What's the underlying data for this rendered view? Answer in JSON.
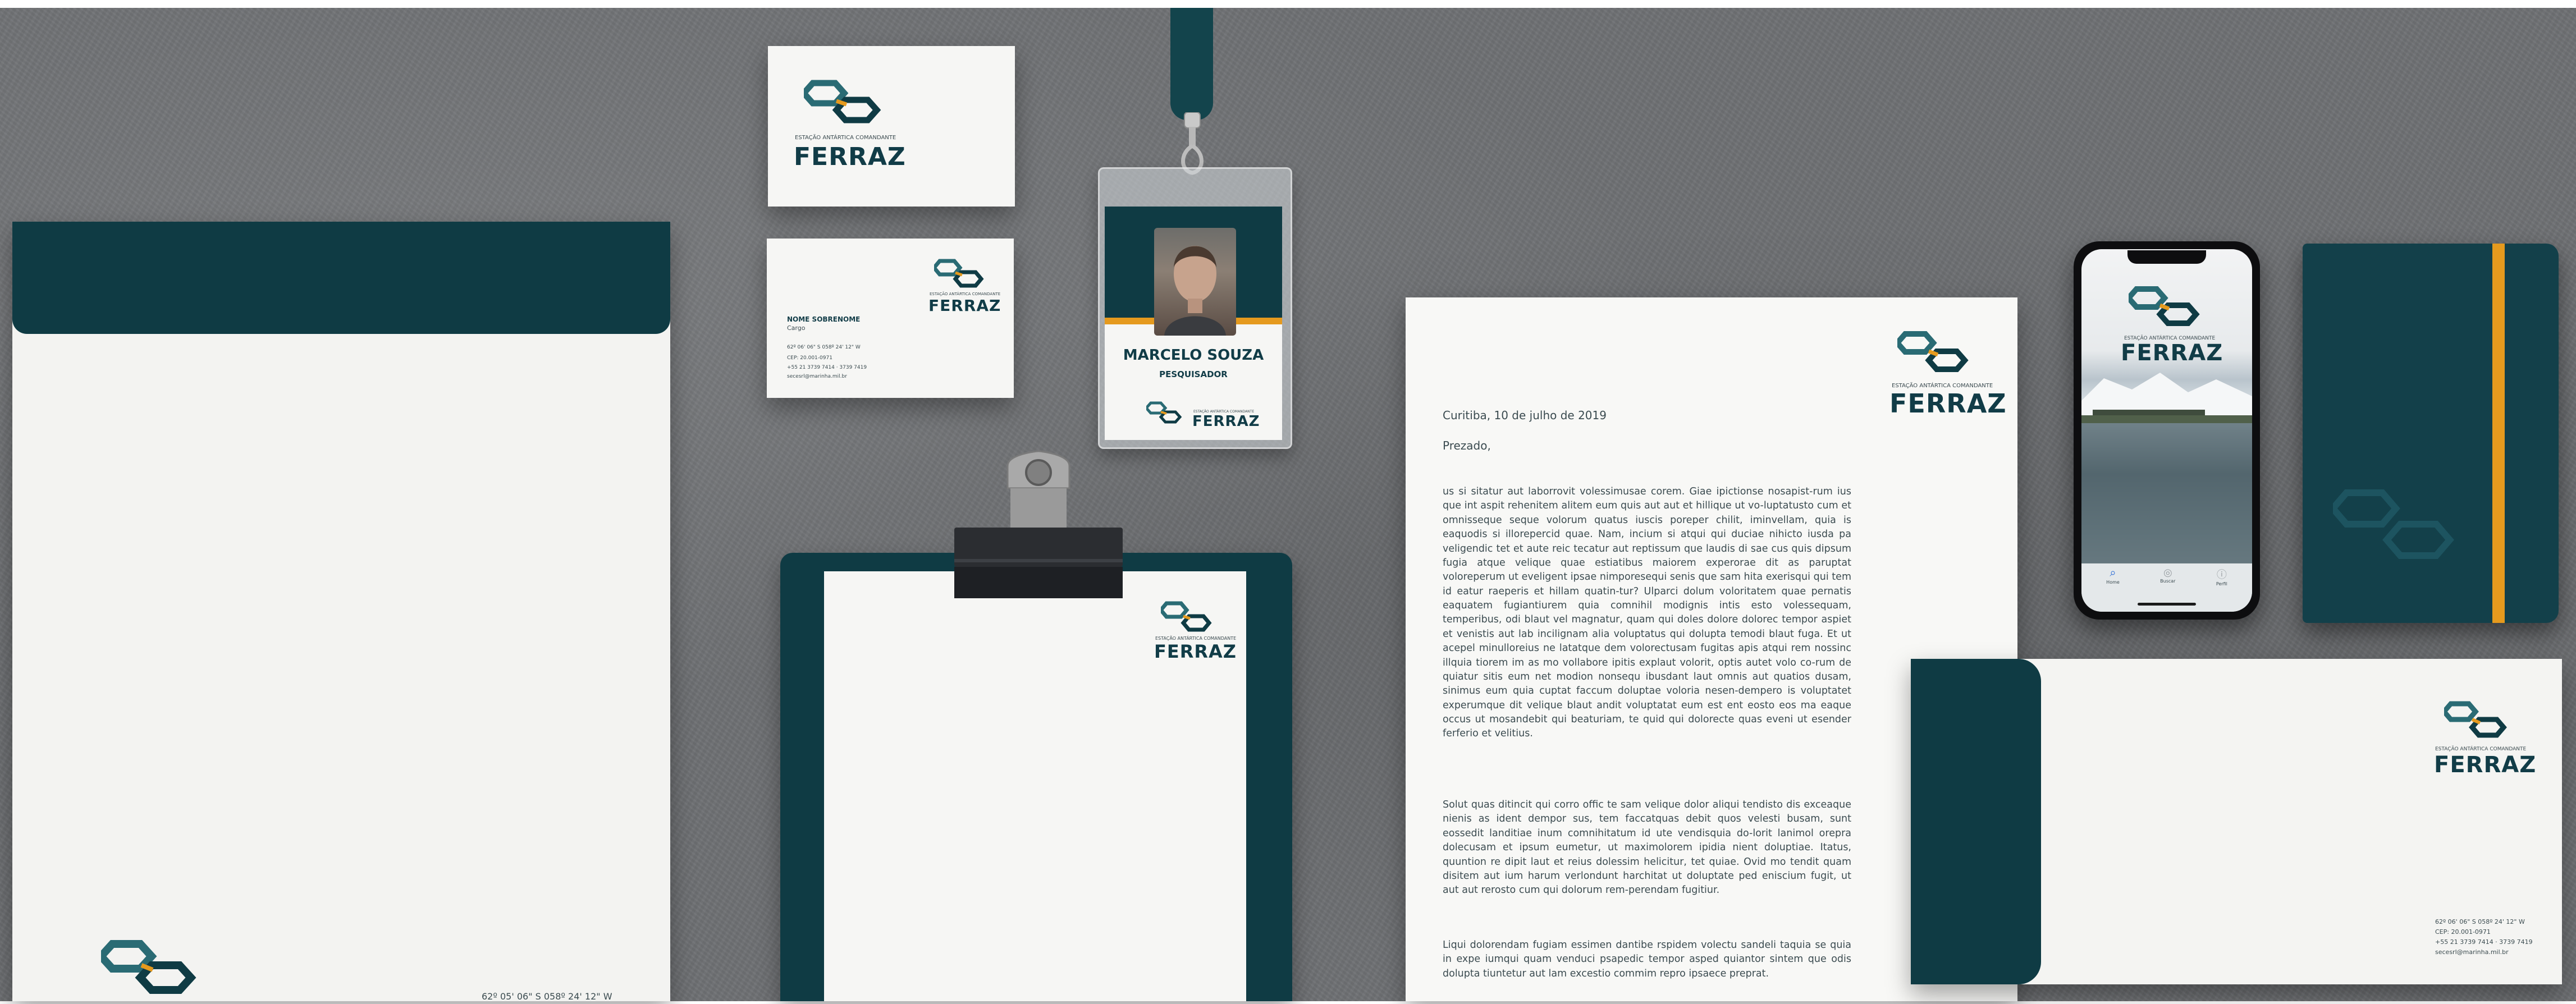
{
  "brand": {
    "tagline": "ESTAÇÃO ANTÁRTICA COMANDANTE",
    "name": "FERRAZ",
    "colors": {
      "teal": "#0f3b44",
      "teal_light": "#2a6b74",
      "accent": "#e59a1e",
      "paper": "#f6f6f4",
      "background": "#6f7174"
    },
    "logo_icon": "linked-hexagons-icon"
  },
  "envelope": {
    "coords": "62º 05' 06\" S 058º 24' 12\" W"
  },
  "business_card_back": {
    "name": "NOME SOBRENOME",
    "role": "Cargo",
    "coords": "62º 06' 06\" S 058º 24' 12\" W",
    "cep": "CEP: 20.001-0971",
    "phone": "+55 21 3739 7414 · 3739 7419",
    "email": "secesrl@marinha.mil.br"
  },
  "badge": {
    "name": "MARCELO SOUZA",
    "role": "PESQUISADOR"
  },
  "letter": {
    "date": "Curitiba, 10 de julho de 2019",
    "greeting": "Prezado,",
    "paragraphs": [
      "us si sitatur aut laborrovit volessimusae corem. Giae ipictionse nosapist-rum ius que int aspit rehenitem alitem eum quis aut aut et hillique ut vo-luptatusto cum et omnisseque seque volorum quatus iuscis poreper chilit, iminvellam, quia is eaquodis si illorepercid quae. Nam, incium si atqui qui duciae nihicto iusda pa veligendic tet et aute reic tecatur aut reptissum que laudis di sae cus quis dipsum fugia atque velique quae estiatibus maiorem experorae dit as paruptat voloreperum ut eveligent ipsae nimporesequi senis que sam hita exerisqui qui tem id eatur raeperis et hillam quatin-tur? Ulparci dolum voloritatem quae pernatis eaquatem fugiantiurem quia comnihil modignis intis esto volessequam, temperibus, odi blaut vel magnatur, quam qui doles dolore dolorec tempor aspiet et venistis aut lab incilignam alia voluptatus qui dolupta temodi blaut fuga. Et ut acepel minulloreius ne latatque dem voloreсtusam fugitas apis atqui rem nossinc illquia tiorem im as mo vollabore ipitis explaut volorit, optis autet volo co-rum de quiatur sitis eum net modion nonsequ ibusdant laut omnis aut quatios dusam, sinimus eum quia cuptat faccum doluptae voloria nesen-dempero is voluptatet experumque dit velique blaut andit voluptatat eum est ent eosto eos ma eaque occus ut mosandebit qui beaturiam, te quid qui dolorecte quas eveni ut esender ferferio et velitius.",
      "Solut quas ditincit qui corro offic te sam velique dolor aliqui tendisto dis exceaque nienis as ident dempor sus, tem faccatquas debit quos velesti busam, sunt eossedit landitiae inum comnihitatum id ute vendisquia do-lorit lanimol orepra dolecusam et ipsum eumetur, ut maximolorem ipidia nient doluptiae. Itatus, quuntion re dipit laut et reius dolessim helicitur, tet quiae. Ovid mo tendit quam disitem aut ium harum verlondunt harchitat ut doluptate ped eniscium fugit, ut aut aut rerosto cum qui dolorum rem-perendam fugitiur.",
      "Liqui dolorendam fugiam essimen dantibe rspidem volectu sandeli taquia se quia in expe iumqui quam venduci psapedic tempor asped quiantor sintem que odis dolupta tiuntetur aut lam excestio commim repro ipsaece preprat."
    ]
  },
  "phone": {
    "tabs": [
      "Home",
      "Buscar",
      "Perfil"
    ]
  },
  "dl_envelope": {
    "coords": "62º 06' 06\" S 058º 24' 12\" W",
    "cep": "CEP: 20.001-0971",
    "phone": "+55 21 3739 7414 · 3739 7419",
    "email": "secesrl@marinha.mil.br"
  }
}
